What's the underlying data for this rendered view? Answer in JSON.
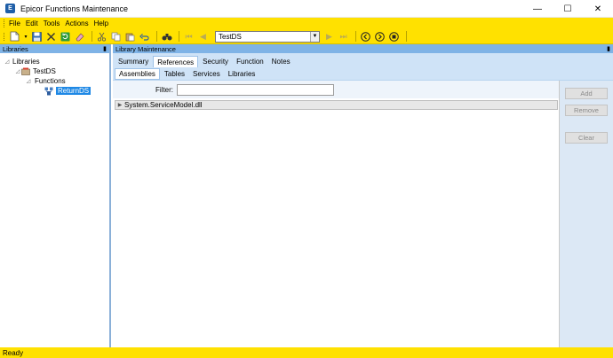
{
  "window": {
    "title": "Epicor Functions Maintenance",
    "app_icon_letter": "E",
    "minimize": "—",
    "maximize": "☐",
    "close": "✕"
  },
  "menu": {
    "items": [
      "File",
      "Edit",
      "Tools",
      "Actions",
      "Help"
    ]
  },
  "toolbar": {
    "combo_value": "TestDS"
  },
  "left_panel": {
    "title": "Libraries",
    "pin": "📌",
    "tree": [
      {
        "label": "Libraries",
        "level": 0,
        "toggle": "◿"
      },
      {
        "label": "TestDS",
        "level": 1,
        "toggle": "◿"
      },
      {
        "label": "Functions",
        "level": 2,
        "toggle": "◿"
      },
      {
        "label": "ReturnDS",
        "level": 3,
        "toggle": ""
      }
    ]
  },
  "right_panel": {
    "title": "Library Maintenance",
    "pin": "📌",
    "tabs": [
      "Summary",
      "References",
      "Security",
      "Function",
      "Notes"
    ],
    "active_tab": "References",
    "subtabs": [
      "Assemblies",
      "Tables",
      "Services",
      "Libraries"
    ],
    "active_subtab": "Assemblies",
    "filter_label": "Filter:",
    "filter_value": "",
    "assemblies": [
      "System.ServiceModel.dll"
    ],
    "buttons": {
      "add": "Add",
      "remove": "Remove",
      "clear": "Clear"
    }
  },
  "status": {
    "text": "Ready"
  },
  "colors": {
    "brand_yellow": "#ffe100",
    "panel_blue": "#7fb3e6",
    "tab_blue": "#cfe3f7",
    "selection": "#1e88e5"
  }
}
